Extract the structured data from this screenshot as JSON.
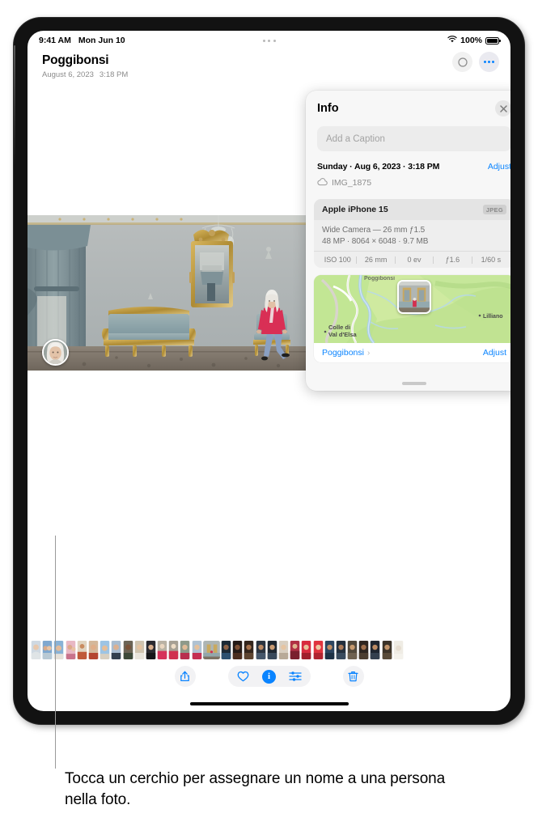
{
  "statusbar": {
    "time": "9:41 AM",
    "date": "Mon Jun 10",
    "wifi_icon": "wifi-icon",
    "battery_pct": "100%",
    "battery_icon": "battery-full-icon",
    "multitask_icon": "multitasking-dots-icon"
  },
  "header": {
    "title": "Poggibonsi",
    "date": "August 6, 2023",
    "time": "3:18 PM",
    "more_icon": "more-options-icon",
    "select_icon": "select-icon"
  },
  "info": {
    "title": "Info",
    "close_icon": "close-icon",
    "caption_placeholder": "Add a Caption",
    "date_text": "Sunday · Aug 6, 2023 · 3:18 PM",
    "adjust_label": "Adjust",
    "cloud_icon": "icloud-icon",
    "file_name": "IMG_1875",
    "camera": {
      "model": "Apple iPhone 15",
      "format": "JPEG",
      "lens": "Wide Camera — 26 mm ƒ1.5",
      "resolution": "48 MP · 8064 × 6048 · 9.7 MB",
      "exif": [
        "ISO 100",
        "26 mm",
        "0 ev",
        "ƒ1.6",
        "1/60 s"
      ]
    },
    "map": {
      "labels": [
        "Poggibonsi",
        "Colle di",
        "Val d'Elsa",
        "Lilliano"
      ],
      "place_link": "Poggibonsi",
      "chevron_icon": "chevron-right-icon",
      "adjust_label": "Adjust",
      "pin_icon": "photo-pin-icon"
    },
    "grabber_icon": "resize-grabber-icon"
  },
  "photo": {
    "face_bubble_icon": "face-circle-icon"
  },
  "toolbar": {
    "share_icon": "share-icon",
    "favorite_icon": "heart-icon",
    "info_icon": "info-icon",
    "adjust_icon": "adjustments-icon",
    "delete_icon": "trash-icon"
  },
  "callout": {
    "text": "Tocca un cerchio per assegnare un nome a una persona nella foto."
  },
  "colors": {
    "accent": "#0a84ff",
    "panel_bg": "#f7f7f7",
    "card_bg": "#eeeeee",
    "muted_text": "#8e8e8e"
  }
}
